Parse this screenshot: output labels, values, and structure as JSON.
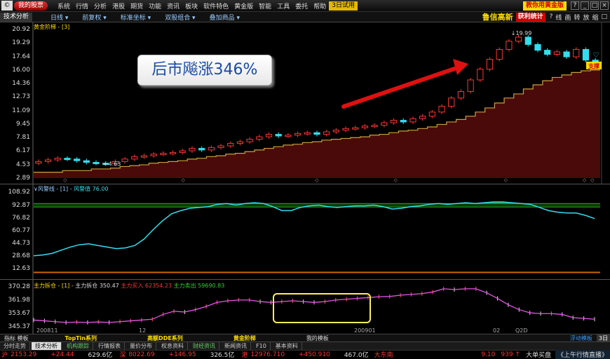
{
  "menubar": {
    "logo": "©",
    "my_button": "我的股票",
    "items": [
      "系统",
      "行情",
      "分析",
      "港股",
      "期货",
      "功能",
      "资讯",
      "板块",
      "软件特色",
      "黄金版",
      "智能",
      "工具",
      "委托",
      "帮助"
    ],
    "highlight": "3日试用",
    "promo": "教你用黄金版",
    "win_buttons": [
      "?",
      "_",
      "□",
      "×"
    ]
  },
  "toolbar": {
    "tab": "技术分析",
    "dropdowns": [
      "日线 ▾",
      "前复权 ▾",
      "标准坐标 ▾",
      "双股组合 ▾",
      "叠加商品 ▾"
    ],
    "stock_name": "鲁信高新",
    "red_button": "获利统计",
    "tool_buttons": [
      "?",
      "线",
      "画",
      "转",
      "放",
      "缩",
      "□"
    ]
  },
  "main_panel": {
    "legend": "黄金阶梯 - [3]",
    "y_ticks": [
      "20.92",
      "19.29",
      "17.64",
      "16.00",
      "14.36",
      "12.73",
      "11.09",
      "9.45",
      "7.81",
      "6.17",
      "4.53",
      "2.89"
    ],
    "high_label": "19.99",
    "low_label": "4.63",
    "support_label": "支撑",
    "callout": "后市飚涨346%"
  },
  "chart_data": {
    "type": "candlestick",
    "close": [
      4.9,
      5.1,
      5.3,
      5.2,
      5.0,
      4.8,
      4.7,
      4.63,
      4.9,
      5.2,
      5.5,
      5.6,
      5.8,
      5.9,
      6.0,
      6.2,
      6.5,
      6.3,
      6.6,
      6.8,
      7.1,
      7.3,
      7.6,
      7.9,
      8.2,
      8.0,
      8.1,
      8.3,
      8.4,
      8.2,
      8.5,
      8.7,
      8.9,
      9.0,
      9.2,
      9.3,
      9.6,
      9.9,
      9.7,
      10.1,
      10.4,
      10.9,
      11.6,
      12.6,
      13.4,
      14.8,
      16.1,
      17.3,
      18.5,
      19.5,
      19.99,
      19.1,
      18.4,
      17.9,
      18.2,
      17.6,
      18.5,
      17.2,
      16.9
    ],
    "support": [
      3.6,
      3.6,
      3.6,
      3.8,
      3.8,
      3.8,
      4.0,
      4.0,
      4.1,
      4.3,
      4.4,
      4.5,
      4.7,
      4.8,
      4.9,
      5.0,
      5.2,
      5.3,
      5.5,
      5.6,
      5.8,
      5.9,
      6.1,
      6.3,
      6.5,
      6.7,
      6.9,
      7.0,
      7.2,
      7.3,
      7.5,
      7.6,
      7.7,
      7.8,
      7.9,
      8.1,
      8.2,
      8.4,
      8.6,
      8.7,
      8.9,
      9.1,
      9.4,
      9.7,
      10.0,
      10.4,
      10.9,
      11.4,
      12.0,
      12.6,
      13.1,
      13.7,
      14.2,
      14.7,
      15.1,
      15.4,
      15.7,
      15.9,
      16.0
    ],
    "ylim": [
      2.89,
      20.92
    ],
    "x_labels": [
      "200811",
      "12",
      "200901",
      "02",
      "Q2D"
    ]
  },
  "panel2": {
    "legend_name": "∨风警线 - [1] -",
    "legend_value": "风警值 76.00",
    "y_ticks": [
      "108.92",
      "92.87",
      "76.82",
      "60.77",
      "44.73",
      "28.68",
      "12.63"
    ],
    "series": [
      29,
      30,
      32,
      36,
      40,
      43,
      44,
      42,
      40,
      38,
      39,
      42,
      50,
      62,
      73,
      82,
      86,
      89,
      90,
      91,
      94,
      95,
      93,
      95,
      96,
      95,
      91,
      86,
      86,
      90,
      92,
      93,
      91,
      90,
      91,
      92,
      92,
      93,
      91,
      88,
      89,
      91,
      92,
      94,
      95,
      94,
      95,
      96,
      95,
      96,
      97,
      97,
      96,
      95,
      94,
      90,
      86,
      84,
      83,
      83,
      80,
      76
    ],
    "ylim": [
      4,
      112
    ],
    "band": [
      90.5,
      95
    ]
  },
  "panel3": {
    "legend_name": "主力拆仓 - [1] -",
    "legend_items": [
      "主力拆仓 350.47",
      "主力买入 62354.23",
      "主力卖出 59690.83"
    ],
    "y_ticks": [
      "370.28",
      "361.98",
      "353.67",
      "345.37"
    ],
    "series": [
      349.5,
      349.0,
      348.5,
      348.0,
      348.2,
      348.0,
      348.3,
      348.0,
      348.5,
      349.0,
      349.5,
      350.0,
      353.0,
      355.0,
      354.5,
      356.0,
      358.0,
      360.5,
      361.5,
      362.0,
      362.0,
      361.0,
      360.5,
      361.0,
      361.5,
      361.0,
      360.5,
      361.0,
      362.0,
      362.5,
      363.0,
      363.5,
      364.0,
      364.2,
      365.0,
      365.5,
      366.0,
      367.0,
      369.0,
      368.5,
      369.0,
      369.0,
      366.5,
      363.0,
      359.0,
      356.0,
      354.0,
      353.5,
      353.5,
      353.0,
      351.0,
      350.5,
      350.0
    ],
    "ylim": [
      344,
      372
    ]
  },
  "bottombar": {
    "first": "指标 模板",
    "items": [
      "TopTin系列",
      "高额DDE系列",
      "黄金阶梯"
    ],
    "plain": "我的模板",
    "float": "浮动模板",
    "ct": "3日"
  },
  "tabbar": {
    "tabs": [
      "分时走势",
      "技术分析",
      "机构跟踪",
      "行情报表",
      "量价分布",
      "权息资料",
      "财经资讯",
      "新闻资讯",
      "F10",
      "基本资料"
    ]
  },
  "statusbar": {
    "sh_label": "沪",
    "sh_index": "2153.29",
    "sh_change": "+24.44",
    "sh_amount": "629.6亿",
    "sz_label": "深",
    "sz_index": "8022.69",
    "sz_change": "+146.95",
    "sz_amount": "326.5亿",
    "hk_label": "港",
    "hk_index": "12976.710",
    "hk_change": "+450.910",
    "hk_amount": "467.0亿",
    "board": "大东南",
    "board_price": "9.10",
    "board_vol": "939 ↑",
    "big_order": "大单买盘",
    "news": "《上午行情直播》"
  },
  "colors": {
    "up": "#ff3333",
    "down": "#33ddee",
    "support_line": "#c8a040",
    "support_fill": "#4a0a0a",
    "line2": "#33ddee",
    "line3": "#e855e8",
    "arrow": "#e01010",
    "box": "#ffee55"
  }
}
